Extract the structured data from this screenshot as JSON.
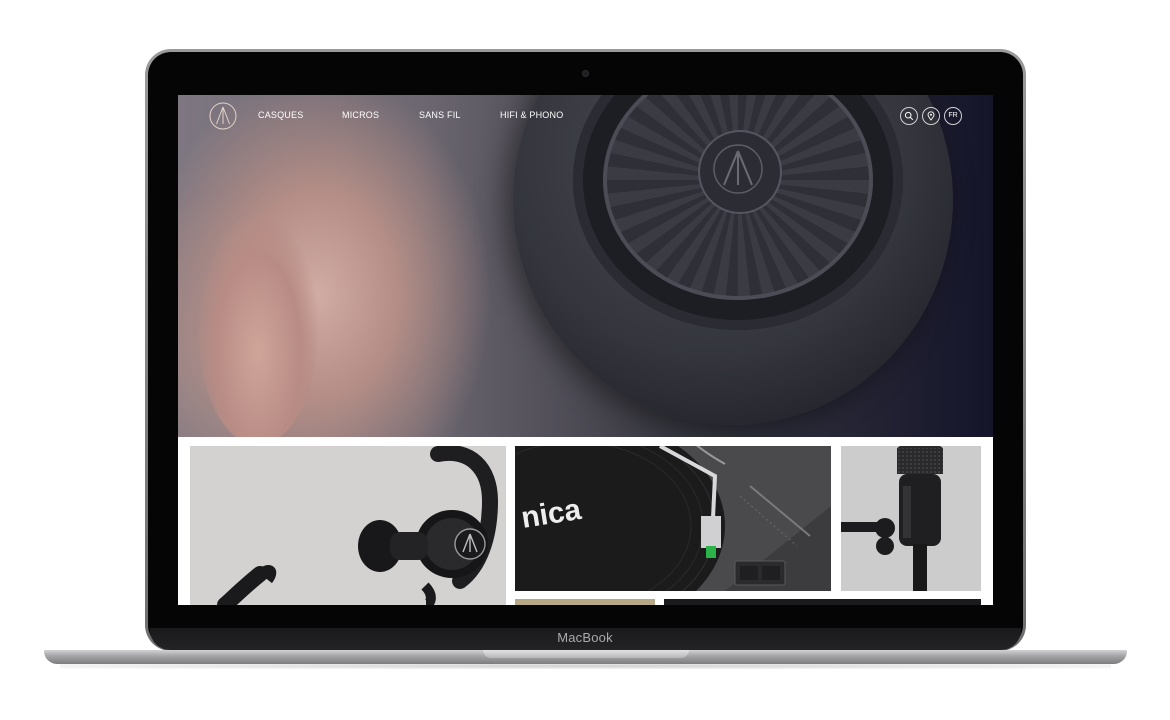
{
  "device": {
    "brand_label": "MacBook"
  },
  "site": {
    "nav": {
      "items": [
        {
          "label": "CASQUES"
        },
        {
          "label": "MICROS"
        },
        {
          "label": "SANS FIL"
        },
        {
          "label": "HIFI & PHONO"
        }
      ],
      "icons": {
        "search": "search-icon",
        "location": "location-pin-icon"
      },
      "language": "FR"
    },
    "products": {
      "turntable_brand_text": "nica"
    }
  },
  "colors": {
    "nav_text": "#ffffff",
    "hero_dark": "#15152a",
    "tile_bg": "#d3d2d1"
  }
}
